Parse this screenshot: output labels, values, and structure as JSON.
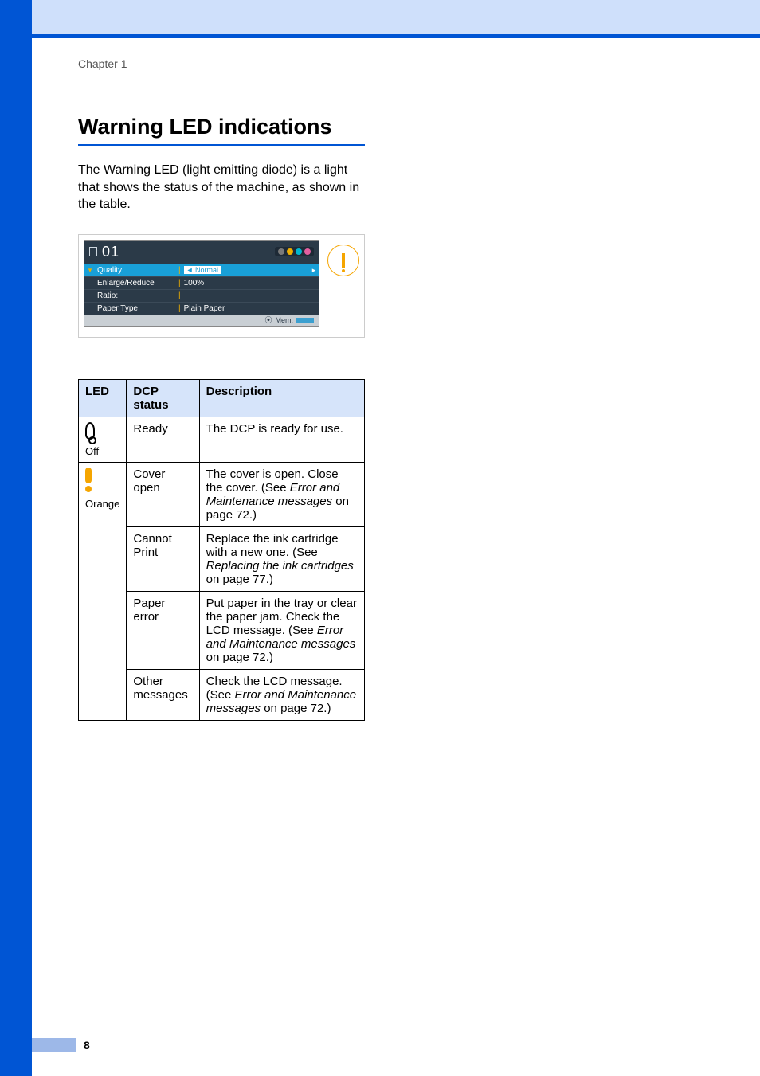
{
  "chapter_label": "Chapter 1",
  "section_title": "Warning LED indications",
  "intro_text": "The Warning LED (light emitting diode) is a light that shows the status of the machine, as shown in the table.",
  "lcd": {
    "doc_count": "01",
    "rows": {
      "quality": {
        "label": "Quality",
        "value_prefix": "◄",
        "value": "Normal"
      },
      "enlarge": {
        "label": "Enlarge/Reduce",
        "value": "100%"
      },
      "ratio": {
        "label": "Ratio:",
        "value": ""
      },
      "paper": {
        "label": "Paper Type",
        "value": "Plain Paper"
      }
    },
    "bottom_label": "Mem."
  },
  "table": {
    "headers": {
      "led": "LED",
      "status": "DCP status",
      "desc": "Description"
    },
    "off_label": "Off",
    "orange_label": "Orange",
    "rows": {
      "ready": {
        "status": "Ready",
        "desc": "The DCP is ready for use."
      },
      "cover": {
        "status": "Cover open",
        "desc_pre": "The cover is open. Close the cover. (See ",
        "desc_em": "Error and Maintenance messages",
        "desc_post": " on page 72.)"
      },
      "cannot": {
        "status": "Cannot Print",
        "desc_pre": "Replace the ink cartridge with a new one. (See ",
        "desc_em": "Replacing the ink cartridges",
        "desc_post": " on page 77.)"
      },
      "paper": {
        "status": "Paper error",
        "desc_pre": "Put paper in the tray or clear the paper jam. Check the LCD message. (See ",
        "desc_em": "Error and Maintenance messages",
        "desc_post": " on page 72.)"
      },
      "other": {
        "status": "Other messages",
        "desc_pre": "Check the LCD message. (See ",
        "desc_em": "Error and Maintenance messages",
        "desc_post": " on page 72.)"
      }
    }
  },
  "page_number": "8"
}
